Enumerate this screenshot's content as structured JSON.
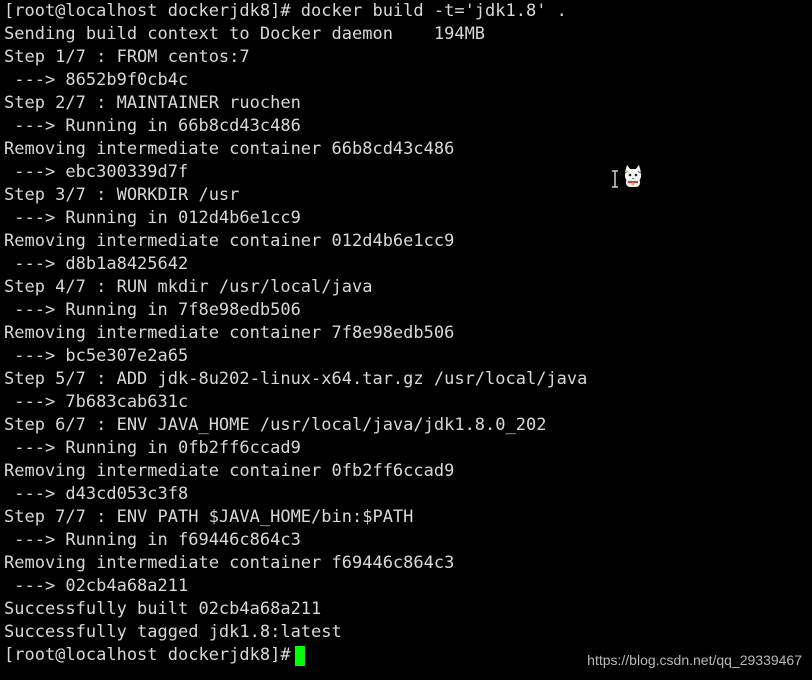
{
  "terminal": {
    "lines": [
      "[root@localhost dockerjdk8]# docker build -t='jdk1.8' .",
      "Sending build context to Docker daemon    194MB",
      "Step 1/7 : FROM centos:7",
      " ---> 8652b9f0cb4c",
      "Step 2/7 : MAINTAINER ruochen",
      " ---> Running in 66b8cd43c486",
      "Removing intermediate container 66b8cd43c486",
      " ---> ebc300339d7f",
      "Step 3/7 : WORKDIR /usr",
      " ---> Running in 012d4b6e1cc9",
      "Removing intermediate container 012d4b6e1cc9",
      " ---> d8b1a8425642",
      "Step 4/7 : RUN mkdir /usr/local/java",
      " ---> Running in 7f8e98edb506",
      "Removing intermediate container 7f8e98edb506",
      " ---> bc5e307e2a65",
      "Step 5/7 : ADD jdk-8u202-linux-x64.tar.gz /usr/local/java",
      " ---> 7b683cab631c",
      "Step 6/7 : ENV JAVA_HOME /usr/local/java/jdk1.8.0_202",
      " ---> Running in 0fb2ff6ccad9",
      "Removing intermediate container 0fb2ff6ccad9",
      " ---> d43cd053c3f8",
      "Step 7/7 : ENV PATH $JAVA_HOME/bin:$PATH",
      " ---> Running in f69446c864c3",
      "Removing intermediate container f69446c864c3",
      " ---> 02cb4a68a211",
      "Successfully built 02cb4a68a211",
      "Successfully tagged jdk1.8:latest"
    ],
    "prompt": "[root@localhost dockerjdk8]#",
    "text_color": "#d8d8d8",
    "background_color": "#000000",
    "cursor_color": "#00ff00"
  },
  "overlay": {
    "mouse_pointer_icon": "text-ibeam-icon",
    "mascot_icon": "cat-mascot-icon"
  },
  "watermark": {
    "text": "https://blog.csdn.net/qq_29339467"
  }
}
